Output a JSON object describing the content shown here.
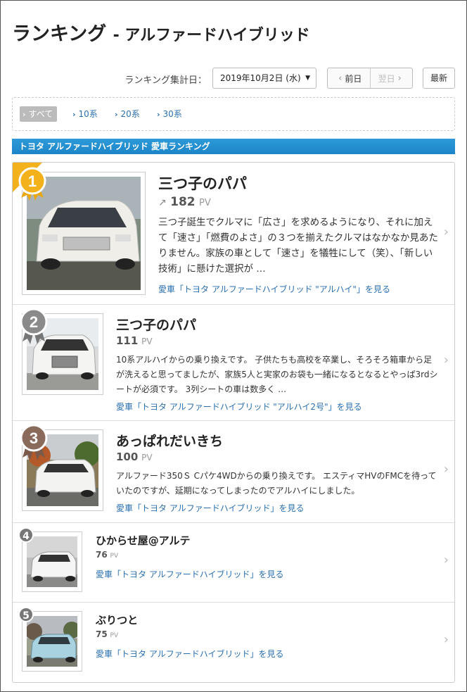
{
  "page": {
    "title": "ランキング",
    "title_sub": "- アルファードハイブリッド"
  },
  "date_bar": {
    "label": "ランキング集計日：",
    "selected_date": "2019年10月2日 (水)",
    "prev_label": "前日",
    "next_label": "翌日",
    "latest_label": "最新"
  },
  "filters": [
    {
      "label": "すべて",
      "active": true
    },
    {
      "label": "10系",
      "active": false
    },
    {
      "label": "20系",
      "active": false
    },
    {
      "label": "30系",
      "active": false
    }
  ],
  "section_title": "トヨタ アルファードハイブリッド 愛車ランキング",
  "ranking": [
    {
      "rank": "1",
      "user": "三つ子のパパ",
      "pv": "182",
      "pv_unit": "PV",
      "description": "三つ子誕生でクルマに「広さ」を求めるようになり、それに加えて「速さ」「燃費のよさ」の３つを揃えたクルマはなかなか見あたりません。家族の車として「速さ」を犠牲にして（笑）、「新しい技術」に懸けた選択が …",
      "link": "愛車「トヨタ アルファードハイブリッド \"アルハイ\"」を見る"
    },
    {
      "rank": "2",
      "user": "三つ子のパパ",
      "pv": "111",
      "pv_unit": "PV",
      "description": "10系アルハイからの乗り換えです。 子供たちも高校を卒業し、そろそろ箱車から足が洗えると思ってましたが、家族5人と実家のお袋も一緒になるとなるとやっぱ3rdシートが必須です。 3列シートの車は数多く …",
      "link": "愛車「トヨタ アルファードハイブリッド \"アルハイ2号\"」を見る"
    },
    {
      "rank": "3",
      "user": "あっぱれだいきち",
      "pv": "100",
      "pv_unit": "PV",
      "description": "アルファード350Ｓ Cパケ4WDからの乗り換えです。 エスティマHVのFMCを待っていたのですが、延期になってしまったのでアルハイにしました。",
      "link": "愛車「トヨタ アルファードハイブリッド」を見る"
    },
    {
      "rank": "4",
      "user": "ひからせ屋@アルテ",
      "pv": "76",
      "pv_unit": "PV",
      "link": "愛車「トヨタ アルファードハイブリッド」を見る"
    },
    {
      "rank": "5",
      "user": "ぶりつと",
      "pv": "75",
      "pv_unit": "PV",
      "link": "愛車「トヨタ アルファードハイブリッド」を見る"
    }
  ],
  "colors": {
    "accent_blue": "#1c85c8",
    "link": "#2a6fb0",
    "gold": "#f3b21c",
    "silver": "#8a8a8a",
    "bronze": "#8a6a5a"
  }
}
